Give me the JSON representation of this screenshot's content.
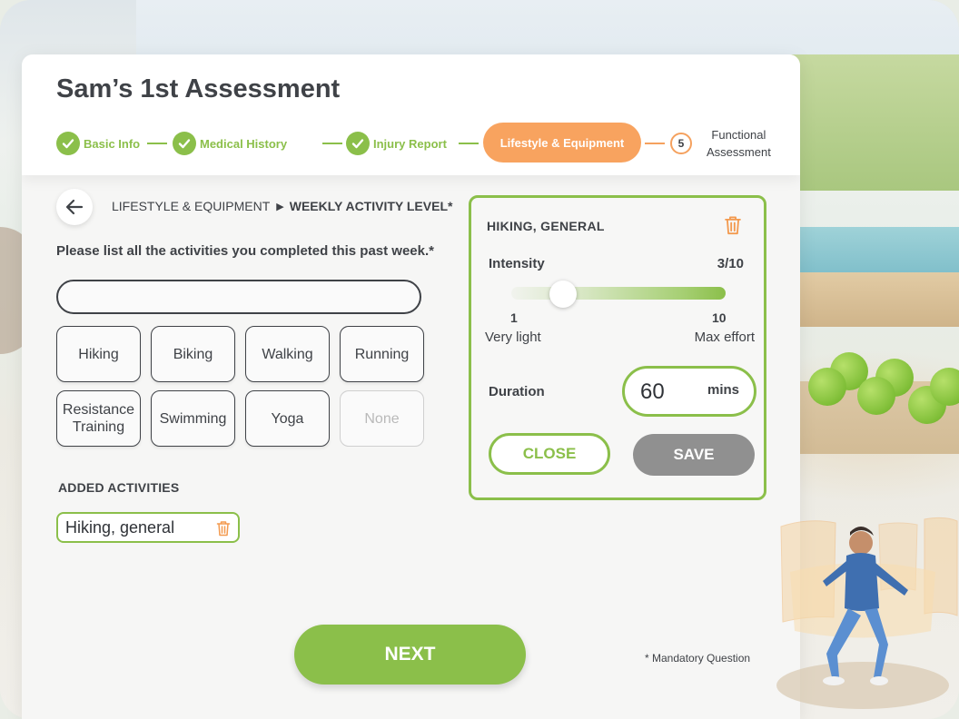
{
  "header": {
    "title": "Sam’s  1st Assessment"
  },
  "stepper": {
    "steps": [
      {
        "label": "Basic Info",
        "status": "complete"
      },
      {
        "label": "Medical History",
        "status": "complete"
      },
      {
        "label": "Injury Report",
        "status": "complete"
      },
      {
        "label": "Lifestyle & Equipment",
        "status": "active"
      },
      {
        "number": "5",
        "label_line1": "Functional",
        "label_line2": "Assessment",
        "status": "upcoming"
      }
    ]
  },
  "breadcrumb": {
    "section": "LIFESTYLE & EQUIPMENT",
    "separator": "▶",
    "current": "WEEKLY ACTIVITY LEVEL*"
  },
  "question": "Please list all the activities you completed this past week.*",
  "search": {
    "value": "",
    "placeholder": ""
  },
  "activities": [
    {
      "label": "Hiking",
      "enabled": true
    },
    {
      "label": "Biking",
      "enabled": true
    },
    {
      "label": "Walking",
      "enabled": true
    },
    {
      "label": "Running",
      "enabled": true
    },
    {
      "label_line1": "Resistance",
      "label_line2": "Training",
      "enabled": true
    },
    {
      "label": "Swimming",
      "enabled": true
    },
    {
      "label": "Yoga",
      "enabled": true
    },
    {
      "label": "None",
      "enabled": false
    }
  ],
  "added": {
    "title": "ADDED ACTIVITIES",
    "items": [
      {
        "label": "Hiking, general"
      }
    ]
  },
  "detail_panel": {
    "title": "HIKING, GENERAL",
    "intensity": {
      "label": "Intensity",
      "value_text": "3/10",
      "value": 3,
      "min": 1,
      "max": 10,
      "min_label": "1",
      "max_label": "10",
      "min_caption": "Very light",
      "max_caption": "Max effort"
    },
    "duration": {
      "label": "Duration",
      "value": "60",
      "unit": "mins"
    },
    "close_label": "CLOSE",
    "save_label": "SAVE"
  },
  "footer": {
    "next_label": "NEXT",
    "mandatory_note": "* Mandatory Question"
  },
  "colors": {
    "accent_green": "#8bbf4a",
    "accent_orange": "#f8a35f",
    "text_dark": "#3f4247",
    "disabled_button": "#909090"
  },
  "icons": [
    "back-arrow-icon",
    "check-icon",
    "trash-icon"
  ]
}
